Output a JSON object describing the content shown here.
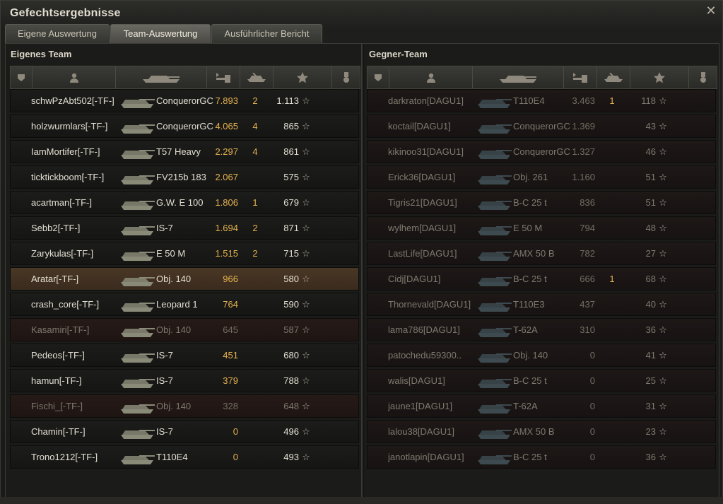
{
  "window": {
    "title": "Gefechtsergebnisse"
  },
  "tabs": [
    {
      "label": "Eigene Auswertung"
    },
    {
      "label": "Team-Auswertung"
    },
    {
      "label": "Ausführlicher Bericht"
    }
  ],
  "own_team": {
    "title": "Eigenes Team",
    "rows": [
      {
        "name": "schwPzAbt502[-TF-]",
        "tank": "ConquerorGC",
        "damage": "7.893",
        "kills": "2",
        "xp": "1.113"
      },
      {
        "name": "holzwurmlars[-TF-]",
        "tank": "ConquerorGC",
        "damage": "4.065",
        "kills": "4",
        "xp": "865"
      },
      {
        "name": "IamMortifer[-TF-]",
        "tank": "T57 Heavy",
        "damage": "2.297",
        "kills": "4",
        "xp": "861"
      },
      {
        "name": "ticktickboom[-TF-]",
        "tank": "FV215b 183",
        "damage": "2.067",
        "kills": "",
        "xp": "575"
      },
      {
        "name": "acartman[-TF-]",
        "tank": "G.W. E 100",
        "damage": "1.806",
        "kills": "1",
        "xp": "679"
      },
      {
        "name": "Sebb2[-TF-]",
        "tank": "IS-7",
        "damage": "1.694",
        "kills": "2",
        "xp": "871"
      },
      {
        "name": "Zarykulas[-TF-]",
        "tank": "E 50 M",
        "damage": "1.515",
        "kills": "2",
        "xp": "715"
      },
      {
        "name": "Aratar[-TF-]",
        "tank": "Obj. 140",
        "damage": "966",
        "kills": "",
        "xp": "580",
        "me": true
      },
      {
        "name": "crash_core[-TF-]",
        "tank": "Leopard 1",
        "damage": "764",
        "kills": "",
        "xp": "590"
      },
      {
        "name": "Kasamiri[-TF-]",
        "tank": "Obj. 140",
        "damage": "645",
        "kills": "",
        "xp": "587",
        "dead": true
      },
      {
        "name": "Pedeos[-TF-]",
        "tank": "IS-7",
        "damage": "451",
        "kills": "",
        "xp": "680"
      },
      {
        "name": "hamun[-TF-]",
        "tank": "IS-7",
        "damage": "379",
        "kills": "",
        "xp": "788"
      },
      {
        "name": "Fischi_[-TF-]",
        "tank": "Obj. 140",
        "damage": "328",
        "kills": "",
        "xp": "648",
        "dead": true
      },
      {
        "name": "Chamin[-TF-]",
        "tank": "IS-7",
        "damage": "0",
        "kills": "",
        "xp": "496"
      },
      {
        "name": "Trono1212[-TF-]",
        "tank": "T110E4",
        "damage": "0",
        "kills": "",
        "xp": "493"
      }
    ]
  },
  "enemy_team": {
    "title": "Gegner-Team",
    "rows": [
      {
        "name": "darkraton[DAGU1]",
        "tank": "T110E4",
        "damage": "3.463",
        "kills": "1",
        "xp": "118"
      },
      {
        "name": "koctail[DAGU1]",
        "tank": "ConquerorGC",
        "damage": "1.369",
        "kills": "",
        "xp": "43"
      },
      {
        "name": "kikinoo31[DAGU1]",
        "tank": "ConquerorGC",
        "damage": "1.327",
        "kills": "",
        "xp": "46"
      },
      {
        "name": "Erick36[DAGU1]",
        "tank": "Obj. 261",
        "damage": "1.160",
        "kills": "",
        "xp": "51"
      },
      {
        "name": "Tigris21[DAGU1]",
        "tank": "B-C 25 t",
        "damage": "836",
        "kills": "",
        "xp": "51"
      },
      {
        "name": "wylhem[DAGU1]",
        "tank": "E 50 M",
        "damage": "794",
        "kills": "",
        "xp": "48"
      },
      {
        "name": "LastLife[DAGU1]",
        "tank": "AMX 50 B",
        "damage": "782",
        "kills": "",
        "xp": "27"
      },
      {
        "name": "Cidj[DAGU1]",
        "tank": "B-C 25 t",
        "damage": "666",
        "kills": "1",
        "xp": "68"
      },
      {
        "name": "Thornevald[DAGU1]",
        "tank": "T110E3",
        "damage": "437",
        "kills": "",
        "xp": "40"
      },
      {
        "name": "lama786[DAGU1]",
        "tank": "T-62A",
        "damage": "310",
        "kills": "",
        "xp": "36"
      },
      {
        "name": "patochedu59300..",
        "tank": "Obj. 140",
        "damage": "0",
        "kills": "",
        "xp": "41"
      },
      {
        "name": "walis[DAGU1]",
        "tank": "B-C 25 t",
        "damage": "0",
        "kills": "",
        "xp": "25"
      },
      {
        "name": "jaune1[DAGU1]",
        "tank": "T-62A",
        "damage": "0",
        "kills": "",
        "xp": "31"
      },
      {
        "name": "lalou38[DAGU1]",
        "tank": "AMX 50 B",
        "damage": "0",
        "kills": "",
        "xp": "23"
      },
      {
        "name": "janotlapin[DAGU1]",
        "tank": "B-C 25 t",
        "damage": "0",
        "kills": "",
        "xp": "36"
      }
    ]
  },
  "icons": {
    "close": "close-icon",
    "star": "star-icon",
    "headers": [
      "platoon-icon",
      "player-icon",
      "tank-icon",
      "damage-icon",
      "kills-icon",
      "xp-icon",
      "medal-icon"
    ]
  }
}
